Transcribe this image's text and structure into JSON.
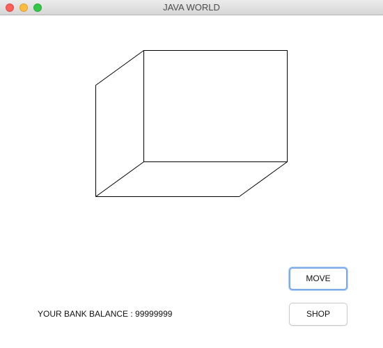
{
  "window": {
    "title": "JAVA WORLD"
  },
  "buttons": {
    "move_label": "MOVE",
    "shop_label": "SHOP"
  },
  "balance": {
    "text": "YOUR BANK BALANCE : 99999999"
  },
  "icons": {
    "close": "close-traffic-light",
    "minimize": "minimize-traffic-light",
    "zoom": "zoom-traffic-light"
  },
  "colors": {
    "close": "#fc605b",
    "minimize": "#fdbc40",
    "zoom": "#34c84a",
    "focus_ring": "#7cabe8"
  }
}
